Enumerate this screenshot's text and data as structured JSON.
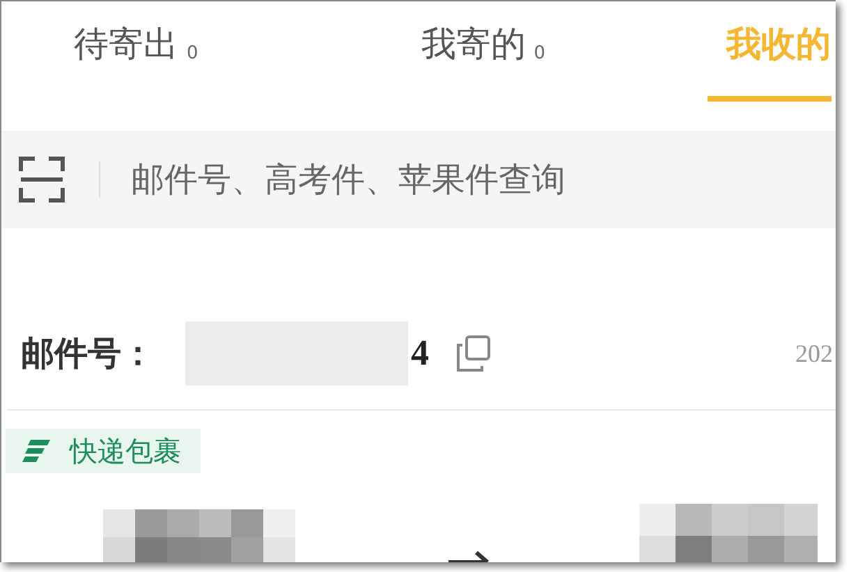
{
  "tabs": [
    {
      "label": "待寄出",
      "count": "0",
      "selected": false
    },
    {
      "label": "我寄的",
      "count": "0",
      "selected": false
    },
    {
      "label": "我收的",
      "selected": true
    }
  ],
  "search": {
    "placeholder": "邮件号、高考件、苹果件查询"
  },
  "item": {
    "label": "邮件号：",
    "number_end": "4",
    "date": "202",
    "tag": "快递包裹"
  }
}
